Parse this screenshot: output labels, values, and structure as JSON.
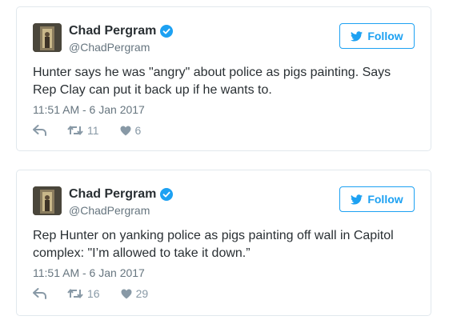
{
  "accent_color": "#1da1f2",
  "tweets": [
    {
      "author_name": "Chad Pergram",
      "handle": "@ChadPergram",
      "follow_label": "Follow",
      "text": "Hunter says he was \"angry\" about police as pigs painting. Says Rep Clay can put it back up if he wants to.",
      "timestamp": "11:51 AM - 6 Jan 2017",
      "retweets": "11",
      "likes": "6",
      "icons": [
        "verified-badge-icon",
        "twitter-bird-icon",
        "reply-icon",
        "retweet-icon",
        "heart-icon"
      ]
    },
    {
      "author_name": "Chad Pergram",
      "handle": "@ChadPergram",
      "follow_label": "Follow",
      "text": "Rep Hunter on yanking police as pigs painting off wall in Capitol complex: \"I’m allowed to take it down.”",
      "timestamp": "11:51 AM - 6 Jan 2017",
      "retweets": "16",
      "likes": "29",
      "icons": [
        "verified-badge-icon",
        "twitter-bird-icon",
        "reply-icon",
        "retweet-icon",
        "heart-icon"
      ]
    }
  ]
}
